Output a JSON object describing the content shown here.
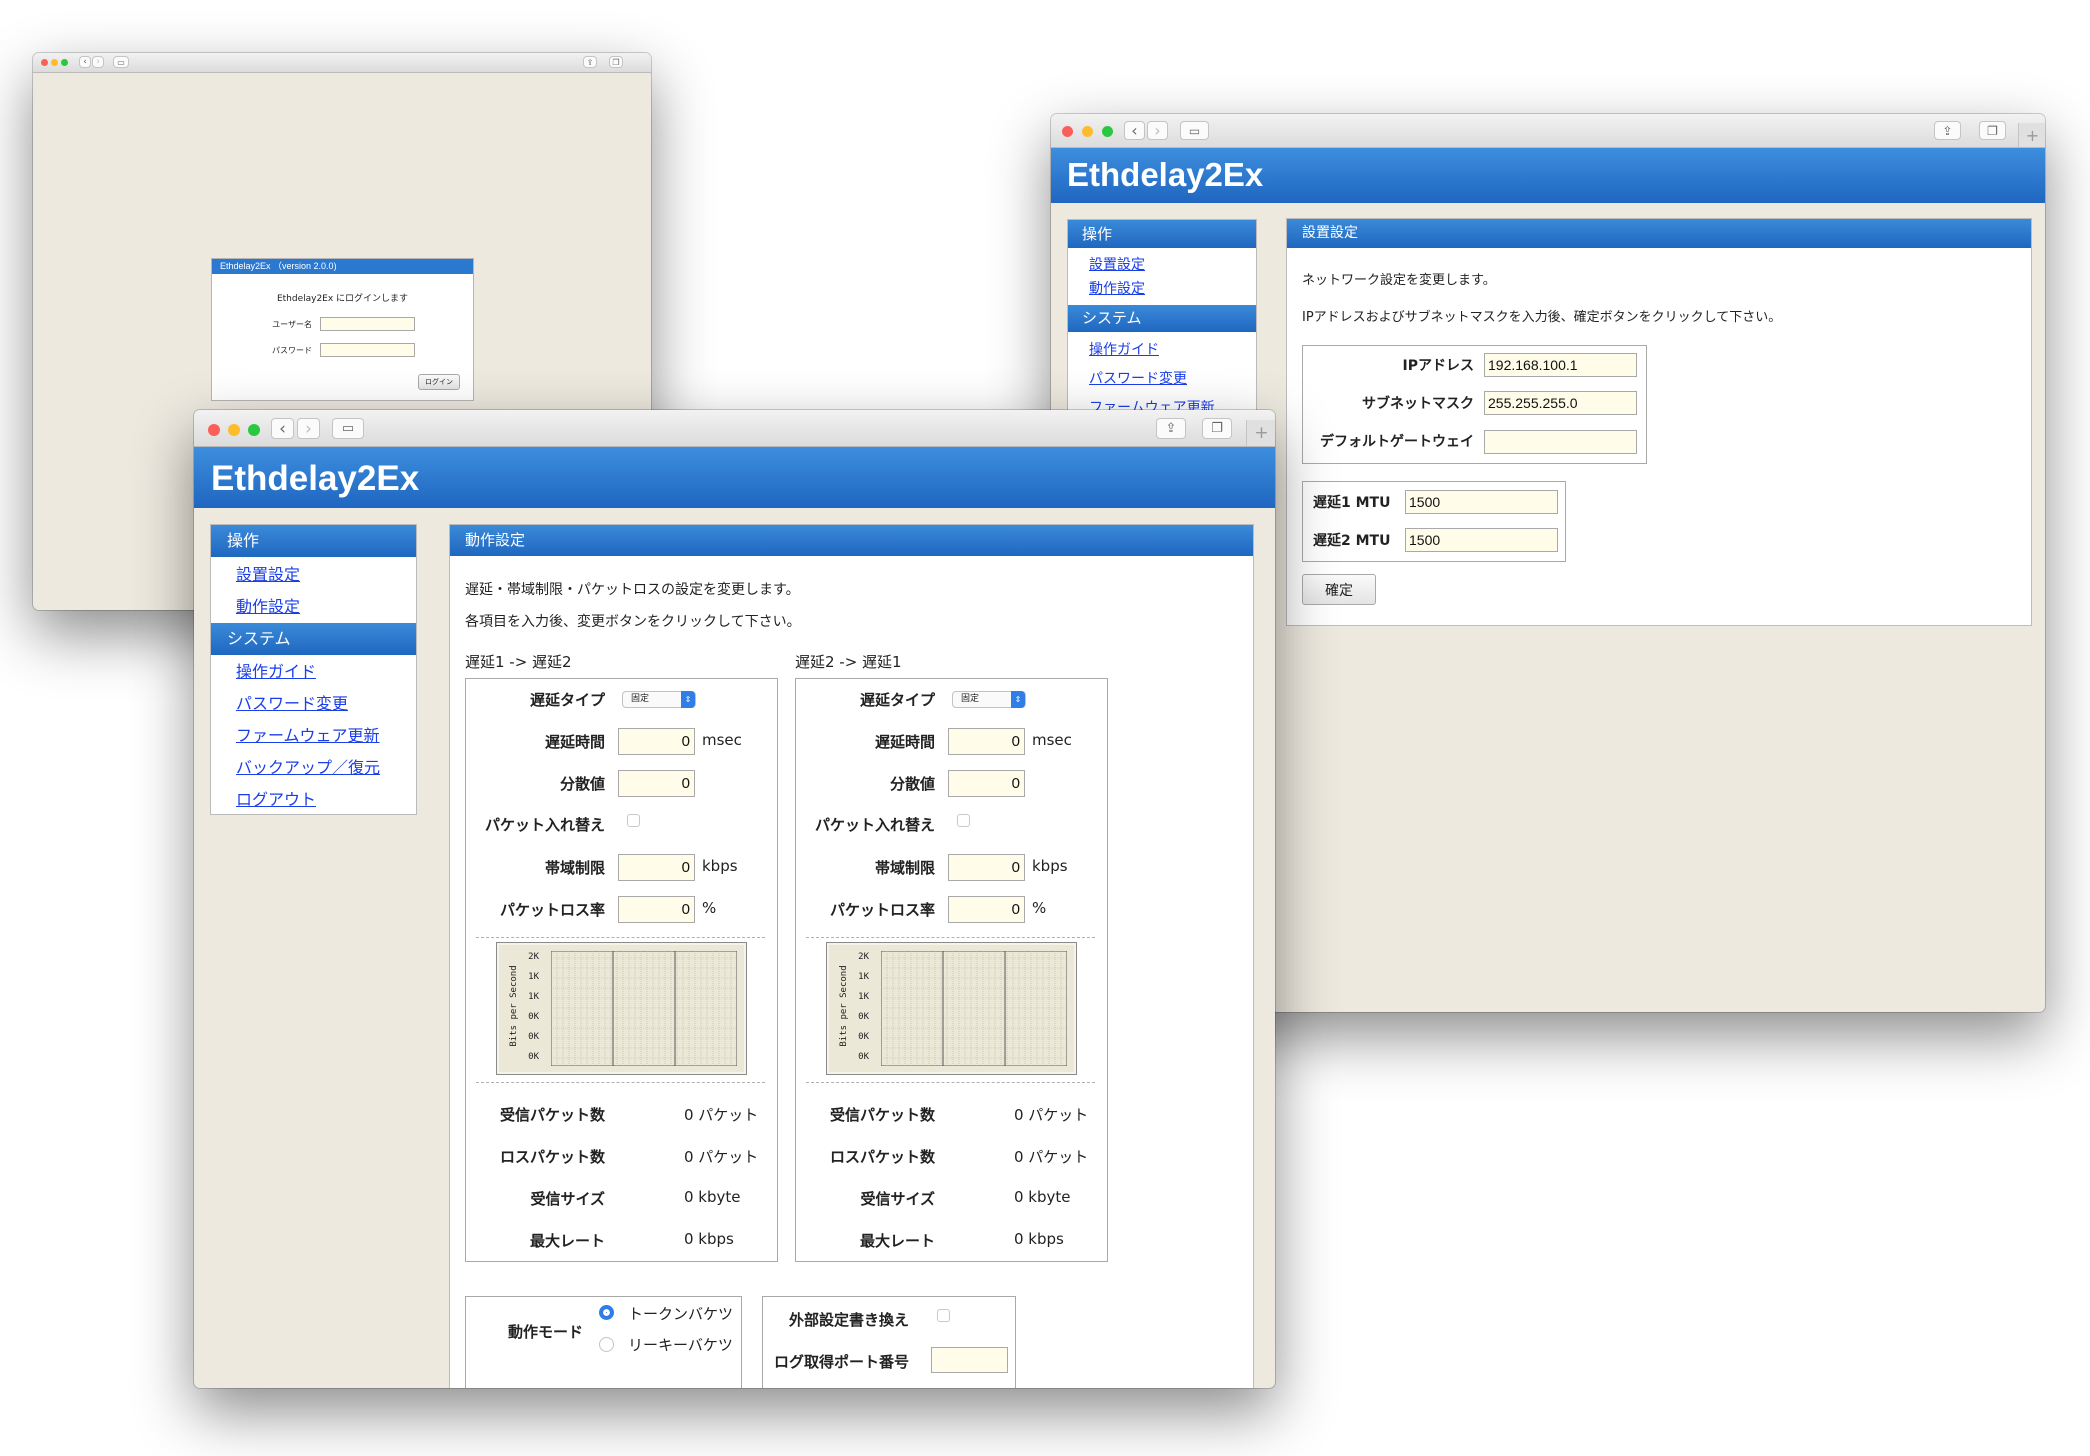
{
  "colors": {
    "header_blue": "#2b78d1",
    "link": "#1a3ee8",
    "field_bg": "#fffde9",
    "window_bg": "#ede9df"
  },
  "login_window": {
    "dialog_title": "Ethdelay2Ex （version 2.0.0)",
    "message": "Ethdelay2Ex にログインします",
    "user_label": "ユーザー名",
    "password_label": "パスワード",
    "login_button": "ログイン"
  },
  "settings_window": {
    "app_title": "Ethdelay2Ex",
    "sidebar": {
      "sections": [
        "操作",
        "システム"
      ],
      "op_items": [
        "設置設定",
        "動作設定"
      ],
      "sys_items": [
        "操作ガイド",
        "パスワード変更",
        "ファームウェア更新"
      ]
    },
    "panel_title": "設置設定",
    "desc1": "ネットワーク設定を変更します。",
    "desc2": "IPアドレスおよびサブネットマスクを入力後、確定ボタンをクリックして下さい。",
    "ip_label": "IPアドレス",
    "ip_value": "192.168.100.1",
    "mask_label": "サブネットマスク",
    "mask_value": "255.255.255.0",
    "gw_label": "デフォルトゲートウェイ",
    "gw_value": "",
    "mtu1_label": "遅延1 MTU",
    "mtu1_value": "1500",
    "mtu2_label": "遅延2 MTU",
    "mtu2_value": "1500",
    "confirm_button": "確定"
  },
  "main_window": {
    "app_title": "Ethdelay2Ex",
    "sidebar": {
      "sections": [
        "操作",
        "システム"
      ],
      "op_items": [
        "設置設定",
        "動作設定"
      ],
      "sys_items": [
        "操作ガイド",
        "パスワード変更",
        "ファームウェア更新",
        "バックアップ／復元",
        "ログアウト"
      ]
    },
    "panel_title": "動作設定",
    "desc1": "遅延・帯域制限・パケットロスの設定を変更します。",
    "desc2": "各項目を入力後、変更ボタンをクリックして下さい。",
    "directions": [
      {
        "title": "遅延1 -> 遅延2",
        "delay_type_label": "遅延タイプ",
        "delay_type_value": "固定",
        "delay_time_label": "遅延時間",
        "delay_time_value": "0",
        "delay_time_unit": "msec",
        "variance_label": "分散値",
        "variance_value": "0",
        "reorder_label": "パケット入れ替え",
        "bandwidth_label": "帯域制限",
        "bandwidth_value": "0",
        "bandwidth_unit": "kbps",
        "loss_label": "パケットロス率",
        "loss_value": "0",
        "loss_unit": "%",
        "graph_ylabel": "Bits per Second",
        "graph_ticks": [
          "2K",
          "1K",
          "1K",
          "0K",
          "0K",
          "0K"
        ],
        "stats": [
          {
            "label": "受信パケット数",
            "value": "0 パケット"
          },
          {
            "label": "ロスパケット数",
            "value": "0 パケット"
          },
          {
            "label": "受信サイズ",
            "value": "0 kbyte"
          },
          {
            "label": "最大レート",
            "value": "0 kbps"
          }
        ]
      },
      {
        "title": "遅延2 -> 遅延1",
        "delay_type_label": "遅延タイプ",
        "delay_type_value": "固定",
        "delay_time_label": "遅延時間",
        "delay_time_value": "0",
        "delay_time_unit": "msec",
        "variance_label": "分散値",
        "variance_value": "0",
        "reorder_label": "パケット入れ替え",
        "bandwidth_label": "帯域制限",
        "bandwidth_value": "0",
        "bandwidth_unit": "kbps",
        "loss_label": "パケットロス率",
        "loss_value": "0",
        "loss_unit": "%",
        "graph_ylabel": "Bits per Second",
        "graph_ticks": [
          "2K",
          "1K",
          "1K",
          "0K",
          "0K",
          "0K"
        ],
        "stats": [
          {
            "label": "受信パケット数",
            "value": "0 パケット"
          },
          {
            "label": "ロスパケット数",
            "value": "0 パケット"
          },
          {
            "label": "受信サイズ",
            "value": "0 kbyte"
          },
          {
            "label": "最大レート",
            "value": "0 kbps"
          }
        ]
      }
    ],
    "mode_label": "動作モード",
    "mode_options": [
      "トークンバケツ",
      "リーキーバケツ"
    ],
    "external_label": "外部設定書き換え",
    "log_port_label": "ログ取得ポート番号"
  }
}
